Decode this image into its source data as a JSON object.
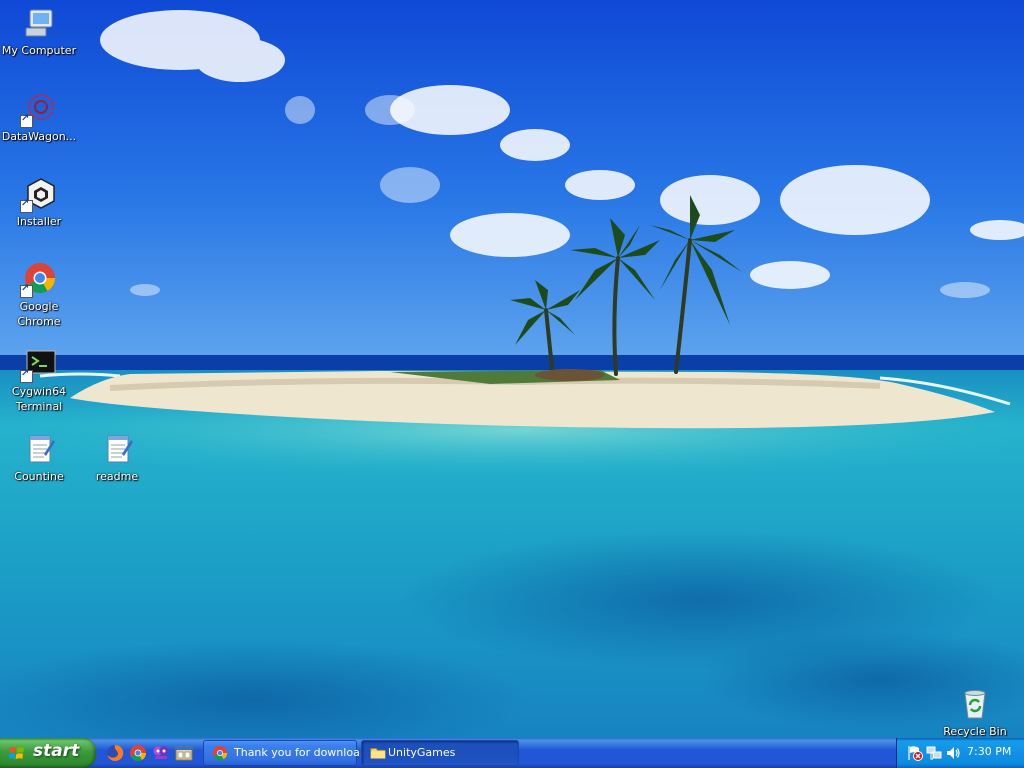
{
  "desktop": {
    "icons": [
      {
        "label": "My Computer"
      },
      {
        "label": "DataWagon..."
      },
      {
        "label": "Installer"
      },
      {
        "label": "Google Chrome"
      },
      {
        "label": "Cygwin64 Terminal"
      },
      {
        "label": "Countine"
      },
      {
        "label": "readme"
      },
      {
        "label": "Recycle Bin"
      }
    ]
  },
  "taskbar": {
    "start_label": "start",
    "quick_launch": [
      {
        "icon": "firefox-icon"
      },
      {
        "icon": "chrome-icon"
      },
      {
        "icon": "people-icon"
      },
      {
        "icon": "explorer-icon"
      }
    ],
    "tasks": [
      {
        "label": "Thank you for downloa...",
        "icon": "chrome-icon",
        "active": false
      },
      {
        "label": "UnityGames",
        "icon": "folder-icon",
        "active": true
      }
    ],
    "tray": {
      "icons": [
        "security-alert-icon",
        "network-icon",
        "volume-icon"
      ],
      "clock": "7:30 PM"
    }
  },
  "colors": {
    "taskbar_blue": "#2157d7",
    "start_green": "#3c9b3c",
    "tray_blue": "#1290e8"
  }
}
